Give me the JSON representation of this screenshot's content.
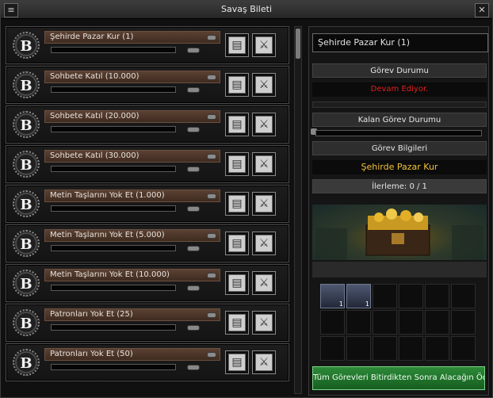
{
  "window": {
    "title": "Savaş Bileti"
  },
  "quests": [
    {
      "badge": "B",
      "name": "Şehirde Pazar Kur (1)"
    },
    {
      "badge": "B",
      "name": "Sohbete Katıl (10.000)"
    },
    {
      "badge": "B",
      "name": "Sohbete Katıl (20.000)"
    },
    {
      "badge": "B",
      "name": "Sohbete Katıl (30.000)"
    },
    {
      "badge": "B",
      "name": "Metin Taşlarını Yok Et (1.000)"
    },
    {
      "badge": "B",
      "name": "Metin Taşlarını Yok Et (5.000)"
    },
    {
      "badge": "B",
      "name": "Metin Taşlarını Yok Et (10.000)"
    },
    {
      "badge": "B",
      "name": "Patronları Yok Et (25)"
    },
    {
      "badge": "B",
      "name": "Patronları Yok Et (50)"
    }
  ],
  "detail": {
    "selected": "Şehirde Pazar Kur (1)",
    "status_header": "Görev Durumu",
    "status_value": "Devam Ediyor.",
    "remaining_header": "Kalan Görev Durumu",
    "info_header": "Görev Bilgileri",
    "quest_name": "Şehirde Pazar Kur",
    "progress": "İlerleme: 0 / 1",
    "reward_button": "Tüm Görevleri Bitirdikten Sonra Alacağın Ödül"
  },
  "rewards": [
    {
      "icon": "scroll-icon",
      "count": "1"
    },
    {
      "icon": "scroll-icon",
      "count": "1"
    }
  ],
  "colors": {
    "accent_red": "#e02020",
    "accent_gold": "#f0c13a",
    "reward_green": "#2c8a38"
  }
}
